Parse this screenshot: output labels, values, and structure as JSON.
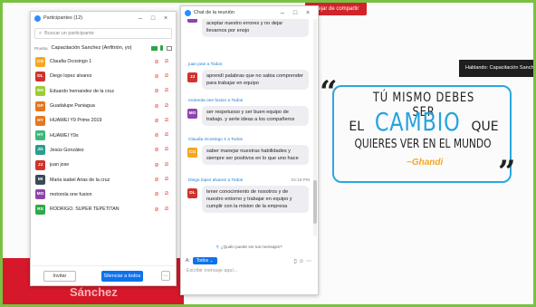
{
  "shared_screen": {
    "stop_share_label": "Dejar de compartir",
    "speaking_label": "Hablando: Capacitación Sanchez",
    "banner_name": "Sánchez",
    "quote": {
      "line1": "TÚ MISMO DEBES SER",
      "line2_prefix": "EL",
      "line2_highlight": "CAMBIO",
      "line2_suffix": "QUE",
      "line3": "QUIERES VER EN EL MUNDO",
      "author": "~Ghandi",
      "colors": {
        "highlight": "#27a3dd",
        "author": "#f5a623",
        "border": "#29a8e0"
      }
    }
  },
  "participants": {
    "title": "Participantes (12)",
    "search_placeholder": "Buscar un participante",
    "host": {
      "tag": "Prueba",
      "name": "Capacitación Sanchez (Anfitrión, yo)"
    },
    "list": [
      {
        "initials": "CO",
        "name": "Claudia Ocosingo 1",
        "color": "#f5a623"
      },
      {
        "initials": "DL",
        "name": "Diego lopez alvarez",
        "color": "#d0332d"
      },
      {
        "initials": "EH",
        "name": "Eduardo hernandez de la cruz",
        "color": "#9ccc3a"
      },
      {
        "initials": "GP",
        "name": "Guadalupe Paniagua",
        "color": "#e5761f"
      },
      {
        "initials": "HY",
        "name": "HUAWEI Y9 Prime 2019",
        "color": "#e5761f"
      },
      {
        "initials": "HY",
        "name": "HUAWEI Y9s",
        "color": "#3cb87a"
      },
      {
        "initials": "JG",
        "name": "Jesús González",
        "color": "#2a9d8f"
      },
      {
        "initials": "JJ",
        "name": "juan jose",
        "color": "#d0332d"
      },
      {
        "initials": "MI",
        "name": "Maria isabel Arias de la cruz",
        "color": "#3a4a5a"
      },
      {
        "initials": "MO",
        "name": "motorola one fusion",
        "color": "#8e44ad"
      },
      {
        "initials": "RS",
        "name": "RODRIGO. SUPER TEPETITAN",
        "color": "#2ea84b"
      }
    ],
    "invite_label": "Invitar",
    "mute_all_label": "Silenciar a todos",
    "more_label": "···"
  },
  "chat": {
    "title": "Chat de la reunión",
    "messages": [
      {
        "from": "",
        "time": "",
        "initials": "",
        "color": "#8e44ad",
        "text": "saber trabajar en equipo y escuchar y aceptar nuestro errores y no dejar llevarnos por enojo"
      },
      {
        "from": "juan jose a Todos",
        "time": "",
        "initials": "JJ",
        "color": "#d0332d",
        "text": "aprendí palabras que no sabia comprender para trabajar en equipo"
      },
      {
        "from": "motorola one fusion a Todos",
        "time": "",
        "initials": "MO",
        "color": "#8e44ad",
        "text": "ser respetuoso y ser buen equipo de trabajo. y serle ideas a los compañeros"
      },
      {
        "from": "Claudia Ocosingo 1 a Todos",
        "time": "",
        "initials": "CO",
        "color": "#f5a623",
        "text": "saber manejar nuestras habilidades y siempre ser positivos en lo que uno hace"
      },
      {
        "from": "Diego lopez alvarez a Todos",
        "time": "04:19 PM",
        "initials": "DL",
        "color": "#d0332d",
        "text": "tener conocimiento de nosotros y de nuestro entorno y trabajar en equipo y cumplir con la mision de la empresa"
      }
    ],
    "visibility_note": "¿Quién puede ver tus mensajes?",
    "to_prefix": "A:",
    "to_value": "Todos ⌄",
    "input_placeholder": "Escribir mensaje aquí..."
  },
  "icons": {
    "zoom": "zoom-logo-icon",
    "search": "search-icon",
    "mic_muted": "mic-muted-icon",
    "video_off": "video-off-icon",
    "file": "file-icon",
    "emoji": "emoji-icon",
    "more": "more-icon"
  }
}
